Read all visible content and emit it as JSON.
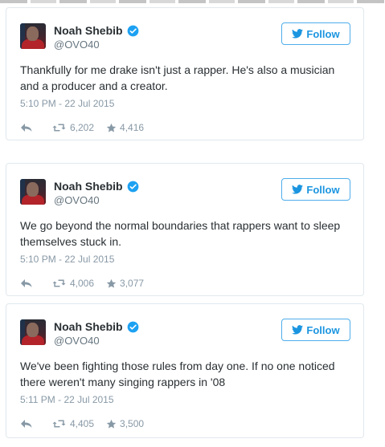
{
  "colors": {
    "accent": "#1b95e0",
    "text": "#292f33",
    "muted": "#8899a6",
    "border": "#e1e8ed"
  },
  "icons": [
    "verified-badge-icon",
    "twitter-bird-icon",
    "reply-icon",
    "retweet-icon",
    "star-icon"
  ],
  "tweets": [
    {
      "name": "Noah Shebib",
      "handle": "@OVO40",
      "follow_label": "Follow",
      "text": "Thankfully for me drake isn't just a rapper. He's also a musician and a producer and a creator.",
      "timestamp": "5:10 PM - 22 Jul 2015",
      "retweets": "6,202",
      "favorites": "4,416"
    },
    {
      "name": "Noah Shebib",
      "handle": "@OVO40",
      "follow_label": "Follow",
      "text": "We go beyond the normal boundaries that rappers want to sleep themselves stuck in.",
      "timestamp": "5:10 PM - 22 Jul 2015",
      "retweets": "4,006",
      "favorites": "3,077"
    },
    {
      "name": "Noah Shebib",
      "handle": "@OVO40",
      "follow_label": "Follow",
      "text": "We've been fighting those rules from day one. If no one noticed there weren't many singing rappers in '08",
      "timestamp": "5:11 PM - 22 Jul 2015",
      "retweets": "4,405",
      "favorites": "3,500"
    }
  ]
}
